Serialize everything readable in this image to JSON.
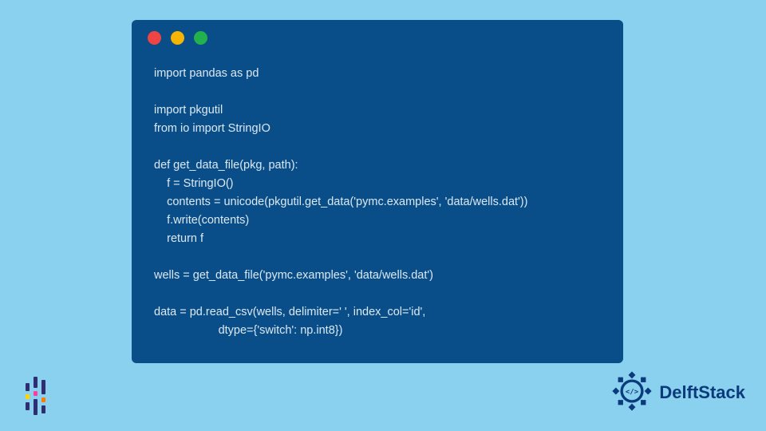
{
  "window": {
    "dots": [
      "red",
      "yellow",
      "green"
    ]
  },
  "code": {
    "lines": [
      "import pandas as pd",
      "",
      "import pkgutil",
      "from io import StringIO",
      "",
      "def get_data_file(pkg, path):",
      "    f = StringIO()",
      "    contents = unicode(pkgutil.get_data('pymc.examples', 'data/wells.dat'))",
      "    f.write(contents)",
      "    return f",
      "",
      "wells = get_data_file('pymc.examples', 'data/wells.dat')",
      "",
      "data = pd.read_csv(wells, delimiter=' ', index_col='id',",
      "                    dtype={'switch': np.int8})"
    ]
  },
  "brand": {
    "name": "DelftStack"
  }
}
